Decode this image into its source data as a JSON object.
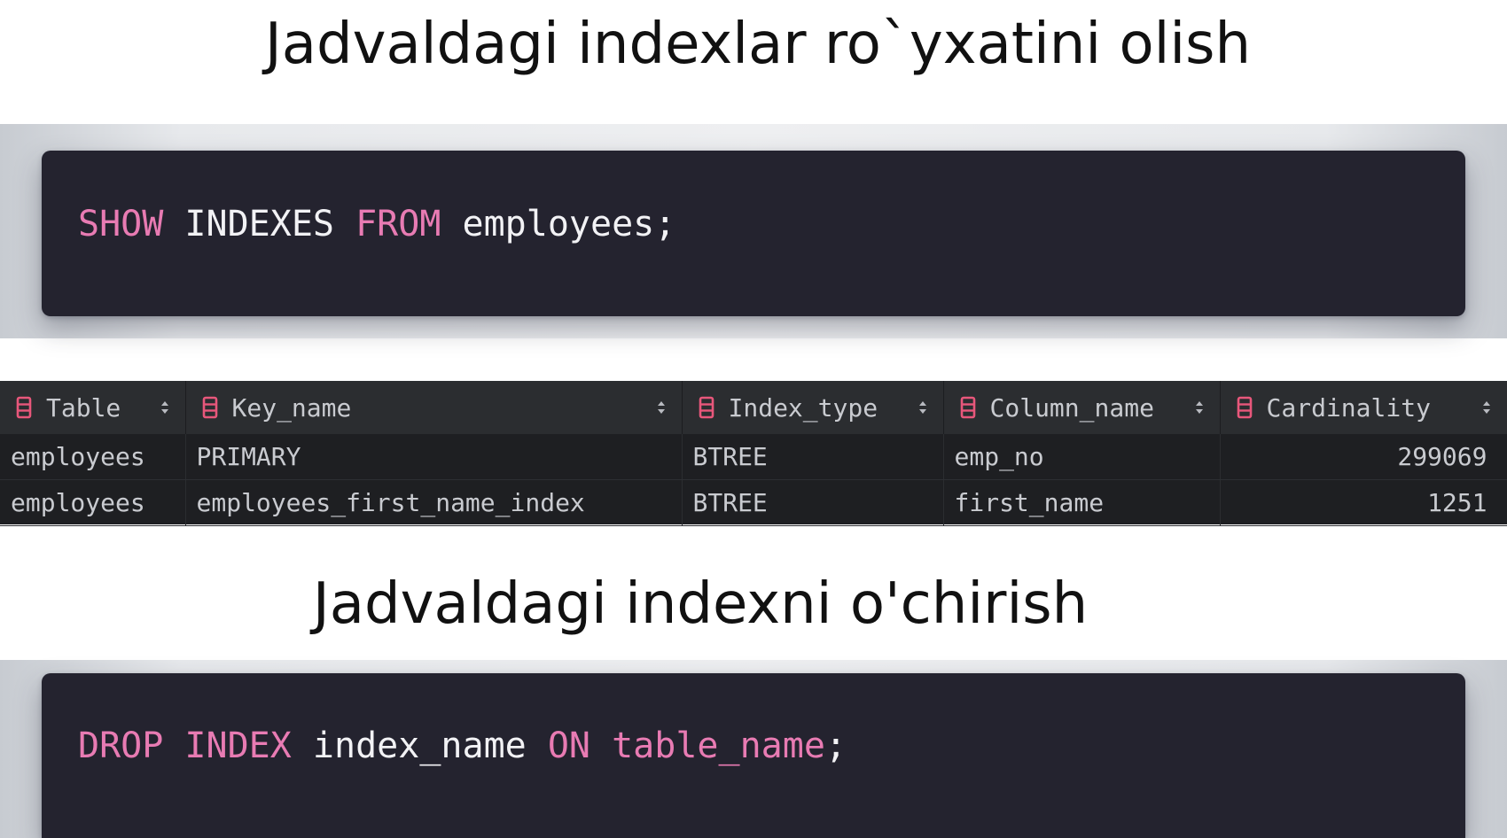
{
  "headings": {
    "list_indexes": "Jadvaldagi indexlar ro`yxatini olish",
    "drop_index": "Jadvaldagi indexni o'chirish"
  },
  "code_show": {
    "kw1": "SHOW",
    "t1": " INDEXES ",
    "kw2": "FROM",
    "t2": " employees;"
  },
  "code_drop": {
    "kw1": "DROP INDEX",
    "t1": " index_name ",
    "kw2": "ON",
    "t2": " ",
    "kw3": "table_name",
    "t3": ";"
  },
  "results": {
    "columns": [
      "Table",
      "Key_name",
      "Index_type",
      "Column_name",
      "Cardinality"
    ],
    "rows": [
      [
        "employees",
        "PRIMARY",
        "BTREE",
        "emp_no",
        "299069"
      ],
      [
        "employees",
        "employees_first_name_index",
        "BTREE",
        "first_name",
        "1251"
      ]
    ],
    "icons": {
      "column": "table-column-icon",
      "sort": "sort-arrows-icon"
    }
  },
  "colors": {
    "keyword": "#e87bb3",
    "code_bg": "#24232f",
    "code_text": "#f2f2f5",
    "table_header_bg": "#2b2d30",
    "table_body_bg": "#1e1f22",
    "column_icon": "#e8577b"
  }
}
